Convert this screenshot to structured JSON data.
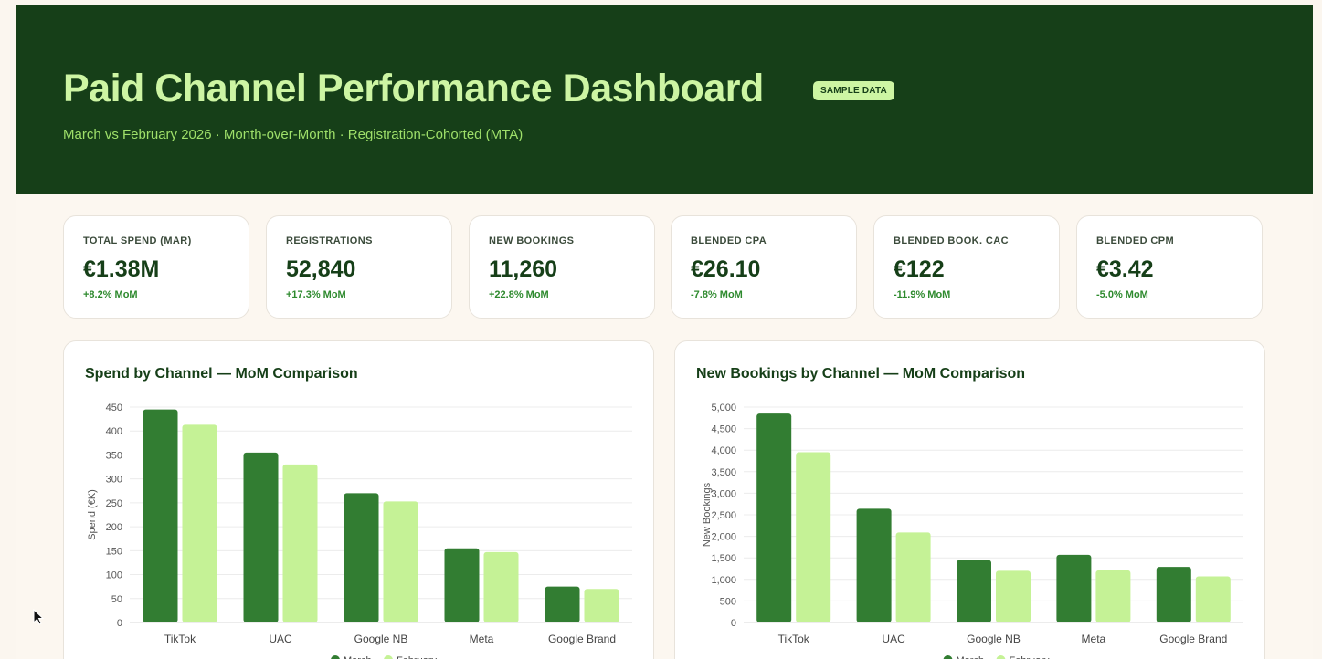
{
  "header": {
    "title": "Paid Channel Performance Dashboard",
    "badge": "SAMPLE DATA",
    "subtitle": "March vs February 2026 · Month-over-Month · Registration-Cohorted (MTA)"
  },
  "kpis": [
    {
      "label": "TOTAL SPEND (MAR)",
      "value": "€1.38M",
      "change": "+8.2% MoM"
    },
    {
      "label": "REGISTRATIONS",
      "value": "52,840",
      "change": "+17.3% MoM"
    },
    {
      "label": "NEW BOOKINGS",
      "value": "11,260",
      "change": "+22.8% MoM"
    },
    {
      "label": "BLENDED CPA",
      "value": "€26.10",
      "change": "-7.8% MoM"
    },
    {
      "label": "BLENDED BOOK. CAC",
      "value": "€122",
      "change": "-11.9% MoM"
    },
    {
      "label": "BLENDED CPM",
      "value": "€3.42",
      "change": "-5.0% MoM"
    }
  ],
  "colors": {
    "header_bg": "#163f18",
    "accent_light": "#cdf5a3",
    "march_bar": "#327d32",
    "february_bar": "#c5f296",
    "positive_text": "#2e8a2e"
  },
  "chart_data": [
    {
      "type": "bar",
      "title": "Spend by Channel — MoM Comparison",
      "ylabel": "Spend (€K)",
      "xlabel": "",
      "categories": [
        "TikTok",
        "UAC",
        "Google NB",
        "Meta",
        "Google Brand"
      ],
      "series": [
        {
          "name": "March",
          "values": [
            445,
            355,
            270,
            155,
            75
          ]
        },
        {
          "name": "February",
          "values": [
            413,
            330,
            253,
            147,
            70
          ]
        }
      ],
      "ylim": [
        0,
        450
      ],
      "yticks": [
        0,
        50,
        100,
        150,
        200,
        250,
        300,
        350,
        400,
        450
      ],
      "ytick_labels": [
        "0",
        "50",
        "100",
        "150",
        "200",
        "250",
        "300",
        "350",
        "400",
        "450"
      ],
      "grid": true,
      "legend": "bottom"
    },
    {
      "type": "bar",
      "title": "New Bookings by Channel — MoM Comparison",
      "ylabel": "New Bookings",
      "xlabel": "",
      "categories": [
        "TikTok",
        "UAC",
        "Google NB",
        "Meta",
        "Google Brand"
      ],
      "series": [
        {
          "name": "March",
          "values": [
            4850,
            2640,
            1450,
            1570,
            1290
          ]
        },
        {
          "name": "February",
          "values": [
            3950,
            2090,
            1200,
            1210,
            1070
          ]
        }
      ],
      "ylim": [
        0,
        5000
      ],
      "yticks": [
        0,
        500,
        1000,
        1500,
        2000,
        2500,
        3000,
        3500,
        4000,
        4500,
        5000
      ],
      "ytick_labels": [
        "0",
        "500",
        "1,000",
        "1,500",
        "2,000",
        "2,500",
        "3,000",
        "3,500",
        "4,000",
        "4,500",
        "5,000"
      ],
      "grid": true,
      "legend": "bottom"
    }
  ]
}
